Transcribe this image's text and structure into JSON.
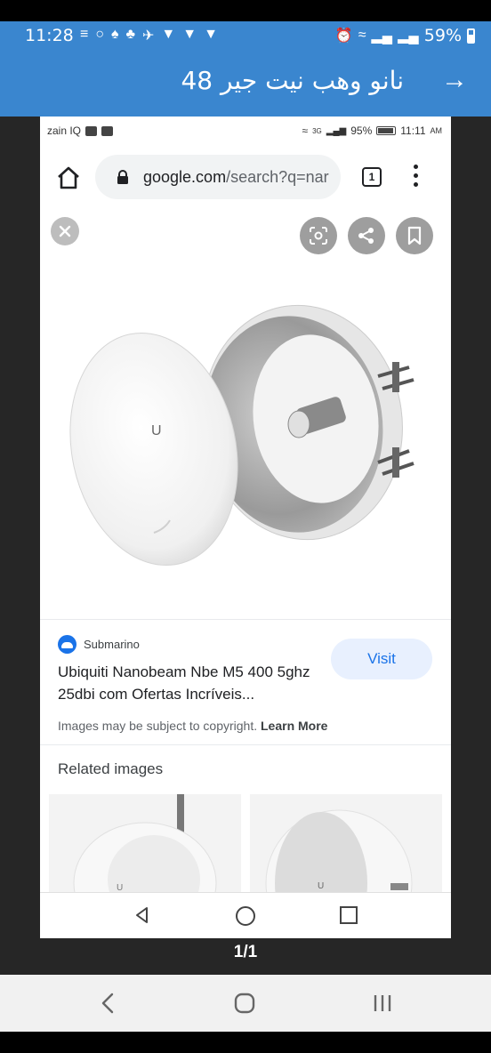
{
  "phone_status": {
    "time": "11:28",
    "battery": "59%"
  },
  "app_header": {
    "title": "نانو وهب نيت جير  48",
    "forward_icon": "arrow-right-icon"
  },
  "inner_status": {
    "carrier": "zain IQ",
    "network": "3G",
    "battery": "95%",
    "time": "11:11",
    "ampm": "AM"
  },
  "browser": {
    "url_domain": "google.com",
    "url_path": "/search?q=nar",
    "tab_count": "1"
  },
  "result": {
    "source": "Submarino",
    "title": "Ubiquiti Nanobeam Nbe M5 400 5ghz 25dbi com Ofertas Incríveis...",
    "visit_label": "Visit",
    "copyright_text": "Images may be subject to copyright.",
    "learn_more": "Learn More",
    "related_title": "Related images"
  },
  "page_counter": "1/1",
  "colors": {
    "header_blue": "#3a86cf",
    "visit_bg": "#e8f0fe",
    "visit_text": "#1a73e8"
  }
}
